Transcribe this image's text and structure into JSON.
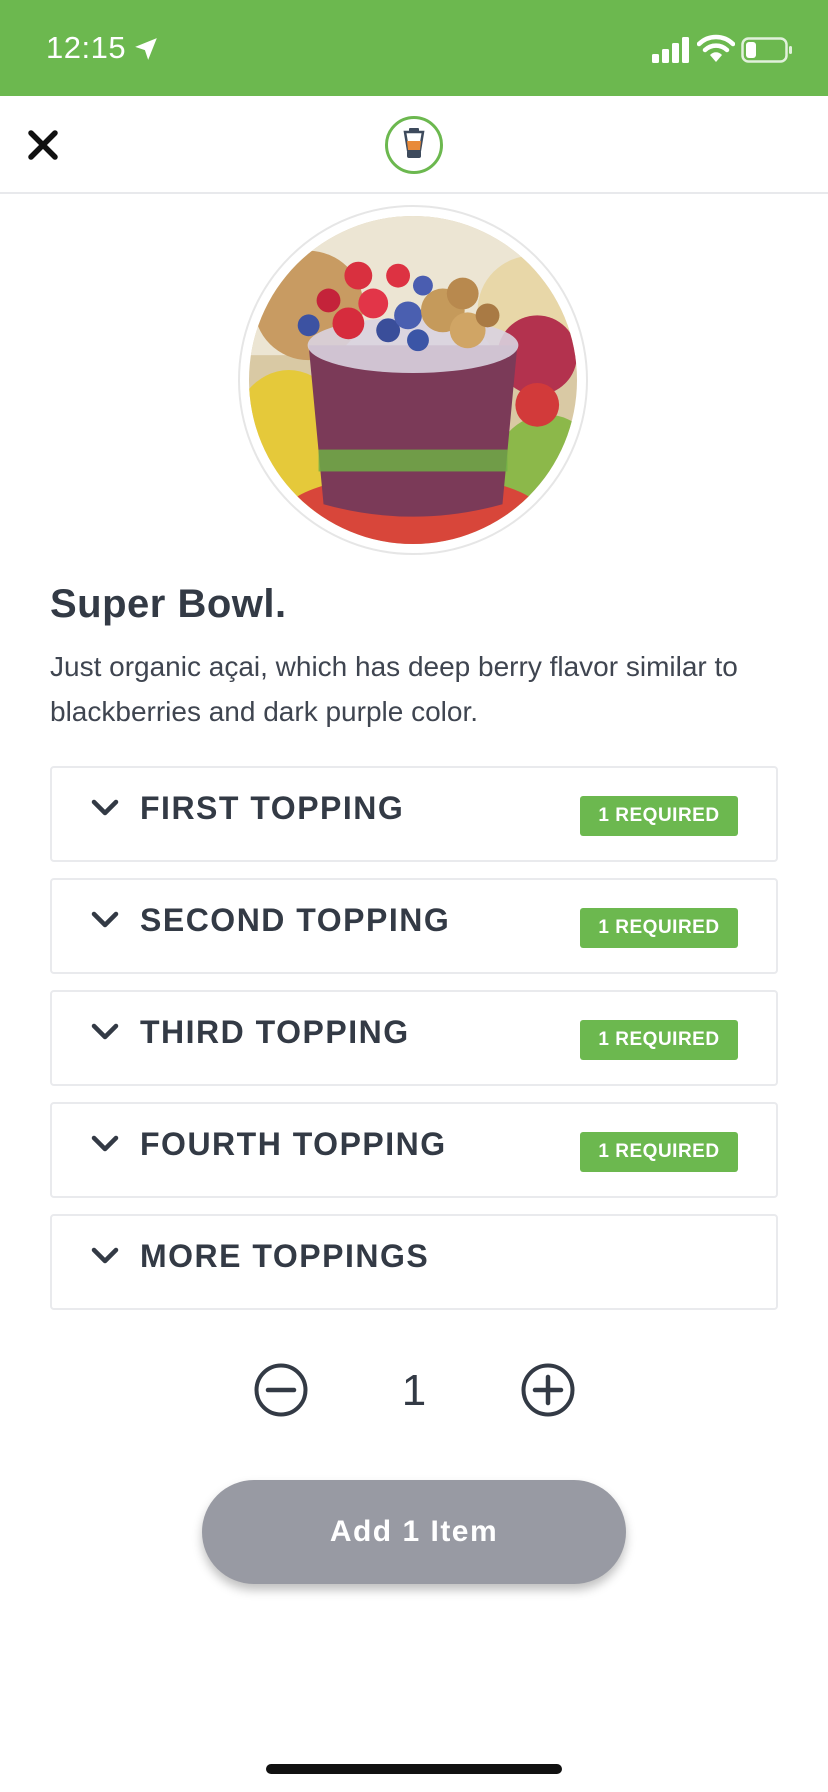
{
  "status_bar": {
    "time": "12:15",
    "icons": [
      "location-arrow-icon",
      "cellular-signal-icon",
      "wifi-icon",
      "battery-icon"
    ],
    "background_color": "#6cb84f"
  },
  "header": {
    "close_icon": "close-icon",
    "logo_icon": "blender-logo-icon"
  },
  "product": {
    "image": "acai-bowl-photo",
    "title": "Super Bowl.",
    "description": "Just organic açai, which has deep berry flavor similar to blackberries and dark purple color."
  },
  "options": [
    {
      "label": "FIRST TOPPING",
      "badge": "1 REQUIRED"
    },
    {
      "label": "SECOND TOPPING",
      "badge": "1 REQUIRED"
    },
    {
      "label": "THIRD TOPPING",
      "badge": "1 REQUIRED"
    },
    {
      "label": "FOURTH TOPPING",
      "badge": "1 REQUIRED"
    },
    {
      "label": "MORE TOPPINGS",
      "badge": null
    }
  ],
  "quantity": {
    "value": "1",
    "minus_icon": "minus-circle-icon",
    "plus_icon": "plus-circle-icon"
  },
  "add_button": {
    "label": "Add 1 Item"
  },
  "colors": {
    "accent": "#6cb84f",
    "button_disabled": "#989aa3",
    "text": "#333a45"
  }
}
